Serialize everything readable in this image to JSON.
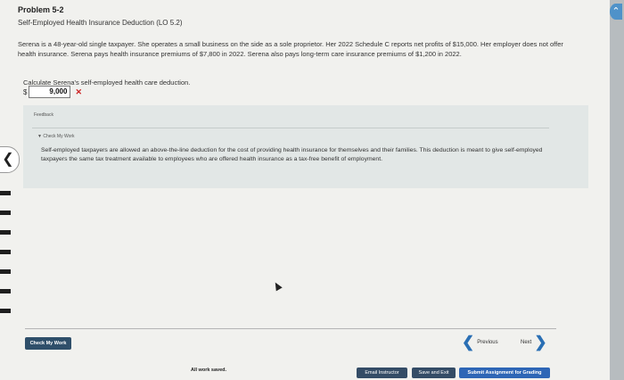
{
  "problem": {
    "title": "Problem 5-2",
    "subtitle": "Self-Employed Health Insurance Deduction (LO 5.2)",
    "text": "Serena is a 48-year-old single taxpayer. She operates a small business on the side as a sole proprietor. Her 2022 Schedule C reports net profits of $15,000. Her employer does not offer health insurance. Serena pays health insurance premiums of $7,800 in 2022. Serena also pays long-term care insurance premiums of $1,200 in 2022."
  },
  "question": {
    "prompt": "Calculate Serena's self-employed health care deduction.",
    "currency_symbol": "$",
    "answer_value": "9,000",
    "result_mark": "✕",
    "result_color": "#cc2222"
  },
  "feedback": {
    "label": "Feedback",
    "check_my_work_label": "▼ Check My Work",
    "text": "Self-employed taxpayers are allowed an above-the-line deduction for the cost of providing health insurance for themselves and their families. This deduction is meant to give self-employed taxpayers the same tax treatment available to employees who are offered health insurance as a tax-free benefit of employment."
  },
  "nav": {
    "back_icon": "chevron-left-icon",
    "back_glyph": "❮",
    "check_my_work_button": "Check My Work",
    "previous_label": "Previous",
    "previous_glyph": "❮",
    "next_label": "Next",
    "next_glyph": "❯"
  },
  "footer": {
    "status": "All work saved.",
    "email_instructor": "Email Instructor",
    "save_and_exit": "Save and Exit",
    "submit": "Submit Assignment for Grading"
  },
  "colors": {
    "accent": "#2e66b6",
    "dark_button": "#344c66",
    "feedback_bg": "#e2e7e6"
  }
}
